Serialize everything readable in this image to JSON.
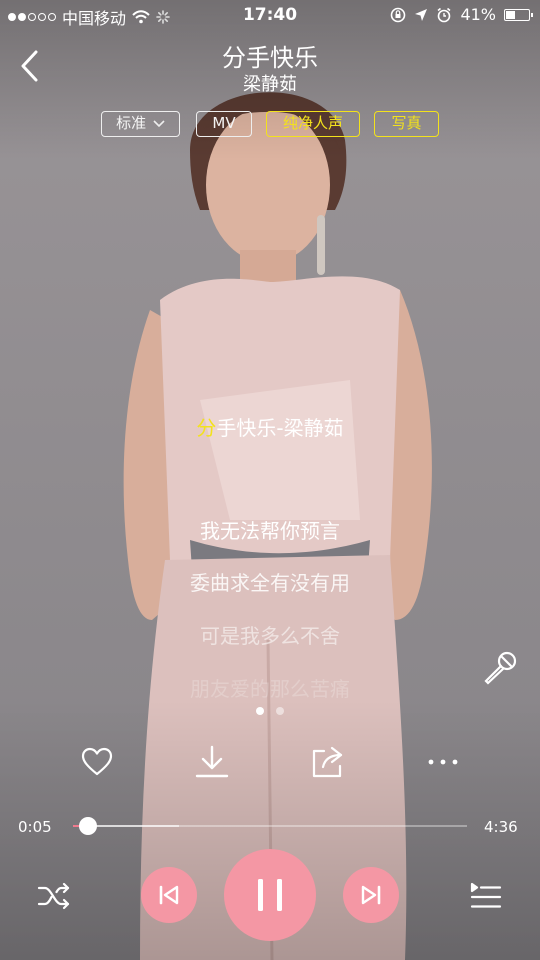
{
  "status_bar": {
    "carrier": "中国移动",
    "time": "17:40",
    "battery": "41%",
    "battery_level": 0.41,
    "signal_bars_filled": 2
  },
  "header": {
    "back_icon": "chevron-left-icon",
    "title": "分手快乐",
    "artist": "梁静茹"
  },
  "tags": {
    "quality": "标准",
    "mv": "MV",
    "pure_vocal": "纯净人声",
    "photo": "写真"
  },
  "lyrics": {
    "title_highlight": "分",
    "title_rest": "手快乐-梁静茹",
    "lines": [
      "我无法帮你预言",
      "委曲求全有没有用",
      "可是我多么不舍",
      "朋友爱的那么苦痛"
    ]
  },
  "pager": {
    "count": 2,
    "active": 0
  },
  "actions": [
    "heart-icon",
    "download-icon",
    "share-icon",
    "more-icon"
  ],
  "progress": {
    "current": "0:05",
    "total": "4:36",
    "played_fraction": 0.018,
    "buffered_fraction": 0.27
  },
  "controls": [
    "shuffle-icon",
    "previous-icon",
    "pause-icon",
    "next-icon",
    "playlist-icon"
  ],
  "colors": {
    "accent": "#f497a4",
    "highlight": "#f3e21c",
    "played": "#f07b8e"
  }
}
